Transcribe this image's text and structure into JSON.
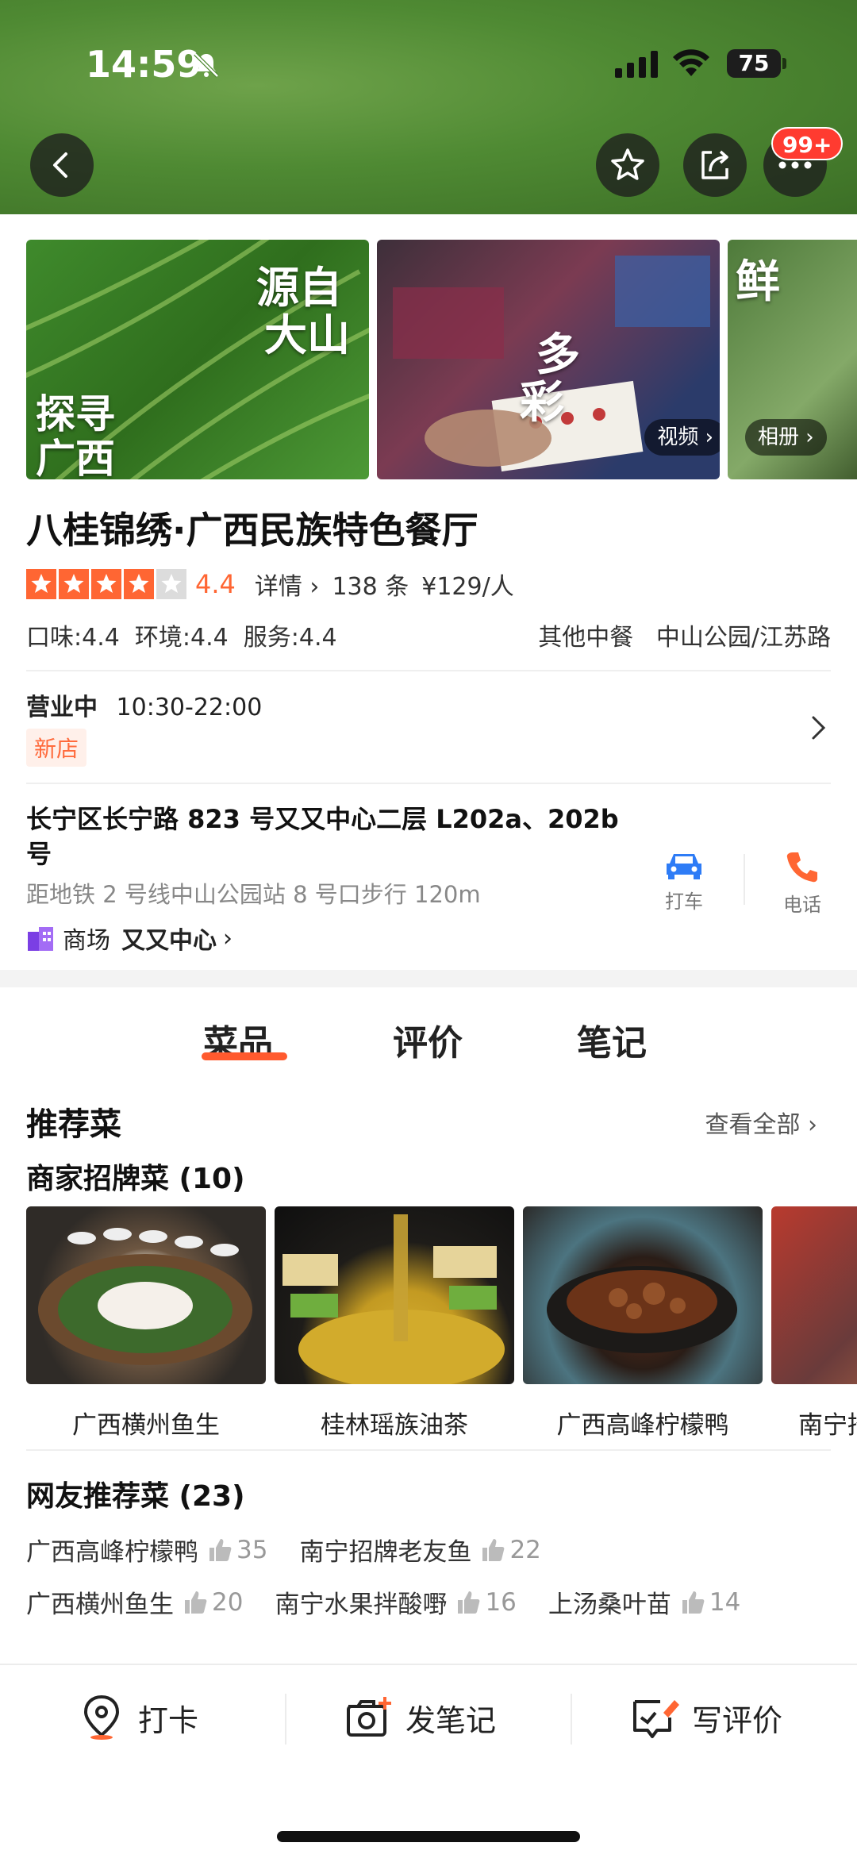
{
  "status_bar": {
    "time": "14:59",
    "battery": "75"
  },
  "header": {
    "badge": "99+",
    "icons": {
      "back": "back-chevron-icon",
      "favorite": "star-outline-icon",
      "share": "share-icon",
      "more": "more-dots-icon"
    }
  },
  "gallery": {
    "items": [
      {
        "overlay_text_1": "源自",
        "overlay_text_2": "大山",
        "overlay_text_3": "探寻",
        "overlay_text_4": "广西"
      },
      {
        "overlay_text_1": "多",
        "overlay_text_2": "彩",
        "pill": "视频"
      },
      {
        "overlay_text_1": "鲜",
        "pill": "相册"
      }
    ]
  },
  "restaurant": {
    "name": "八桂锦绣·广西民族特色餐厅",
    "rating": 4.4,
    "rating_text": "4.4",
    "details_link": "详情",
    "review_count": "138 条",
    "price": "¥129/人",
    "sub_scores": "口味:4.4  环境:4.4  服务:4.4",
    "category": "其他中餐",
    "area": "中山公园/江苏路",
    "status": "营业中",
    "hours": "10:30-22:00",
    "tag": "新店",
    "address": "长宁区长宁路 823 号又又中心二层 L202a、202b 号",
    "subway": "距地铁 2 号线中山公园站 8 号口步行 120m",
    "mall_label": "商场",
    "mall_name": "又又中心",
    "actions": {
      "taxi": "打车",
      "phone": "电话"
    }
  },
  "tabs": [
    {
      "label": "菜品"
    },
    {
      "label": "评价"
    },
    {
      "label": "笔记"
    }
  ],
  "recommend": {
    "title": "推荐菜",
    "see_all": "查看全部",
    "signature_title": "商家招牌菜 (10)",
    "signature_dishes": [
      {
        "name": "广西横州鱼生"
      },
      {
        "name": "桂林瑶族油茶"
      },
      {
        "name": "广西高峰柠檬鸭"
      },
      {
        "name": "南宁招"
      }
    ],
    "user_title": "网友推荐菜 (23)",
    "user_dishes_row1": [
      {
        "name": "广西高峰柠檬鸭",
        "count": "35"
      },
      {
        "name": "南宁招牌老友鱼",
        "count": "22"
      }
    ],
    "user_dishes_row2": [
      {
        "name": "广西横州鱼生",
        "count": "20"
      },
      {
        "name": "南宁水果拌酸嘢",
        "count": "16"
      },
      {
        "name": "上汤桑叶苗",
        "count": "14"
      }
    ]
  },
  "bottom_bar": {
    "checkin": "打卡",
    "post_note": "发笔记",
    "write_review": "写评价"
  },
  "colors": {
    "accent": "#ff5a2e",
    "star": "#ff6633",
    "badge": "#ff3b30",
    "phone": "#ff6633",
    "taxi": "#2e7cf6"
  }
}
